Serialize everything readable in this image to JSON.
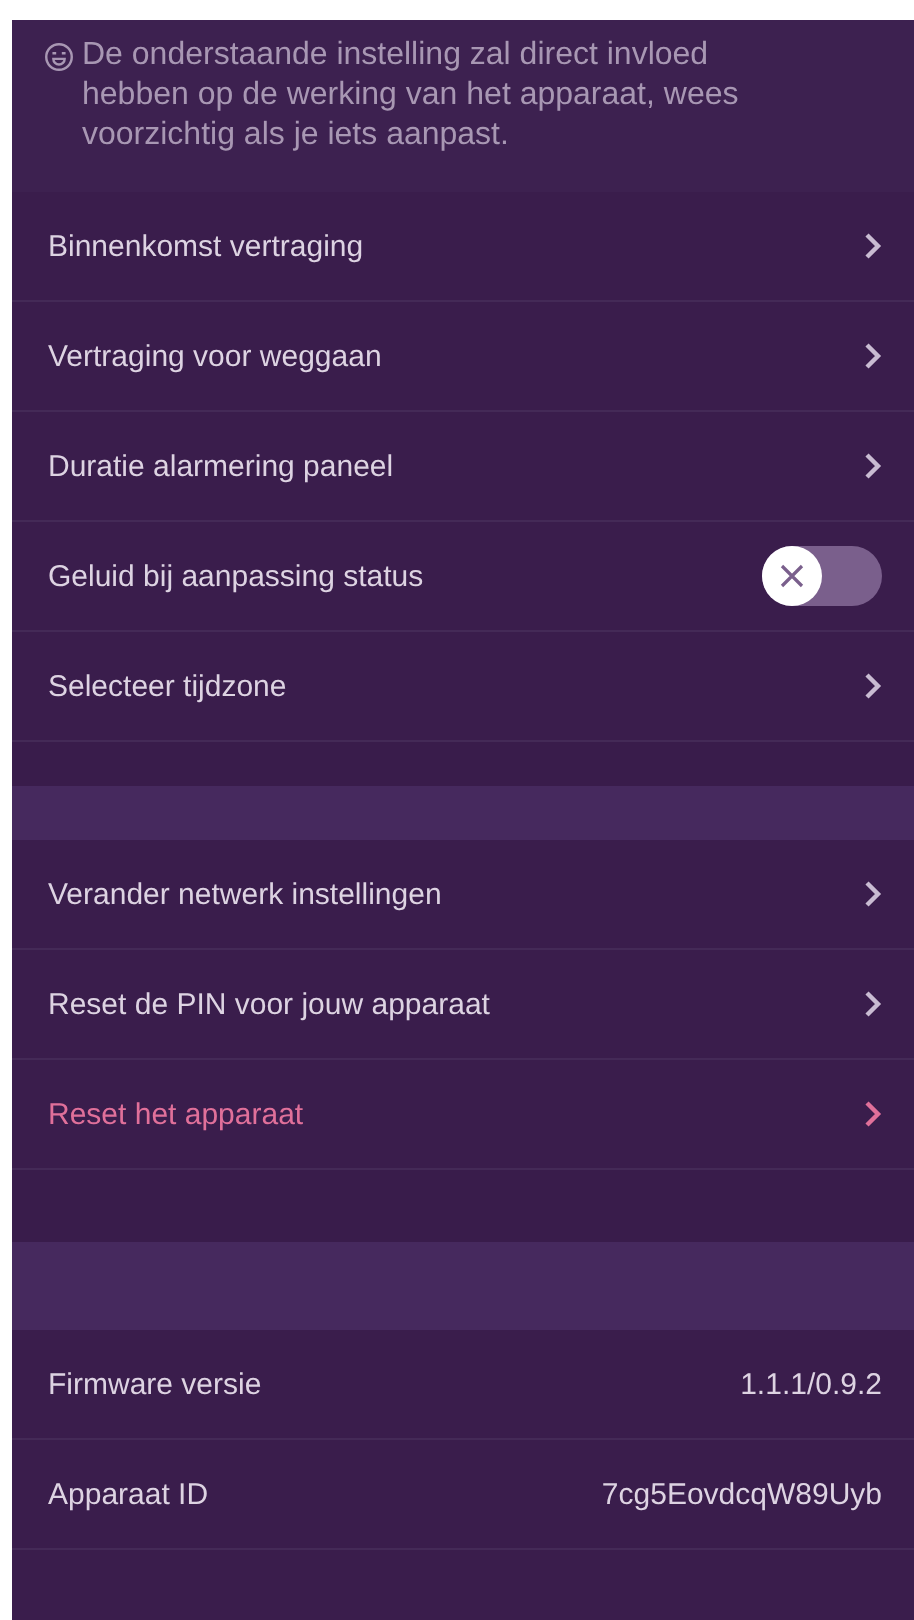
{
  "notice": {
    "text": "De onderstaande instelling zal direct invloed hebben op de werking van het apparaat, wees voorzichtig als je iets aanpast."
  },
  "sections": [
    {
      "rows": [
        {
          "kind": "link",
          "label": "Binnenkomst vertraging",
          "danger": false
        },
        {
          "kind": "link",
          "label": "Vertraging voor weggaan",
          "danger": false
        },
        {
          "kind": "link",
          "label": "Duratie alarmering paneel",
          "danger": false
        },
        {
          "kind": "toggle",
          "label": "Geluid bij aanpassing status",
          "on": false
        },
        {
          "kind": "link",
          "label": "Selecteer tijdzone",
          "danger": false
        }
      ]
    },
    {
      "rows": [
        {
          "kind": "link",
          "label": "Verander netwerk instellingen",
          "danger": false
        },
        {
          "kind": "link",
          "label": "Reset de PIN voor jouw apparaat",
          "danger": false
        },
        {
          "kind": "link",
          "label": "Reset het apparaat",
          "danger": true
        }
      ]
    },
    {
      "rows": [
        {
          "kind": "info",
          "label": "Firmware versie",
          "value": "1.1.1/0.9.2"
        },
        {
          "kind": "info",
          "label": "Apparaat ID",
          "value": "7cg5EovdcqW89Uyb"
        }
      ]
    }
  ]
}
